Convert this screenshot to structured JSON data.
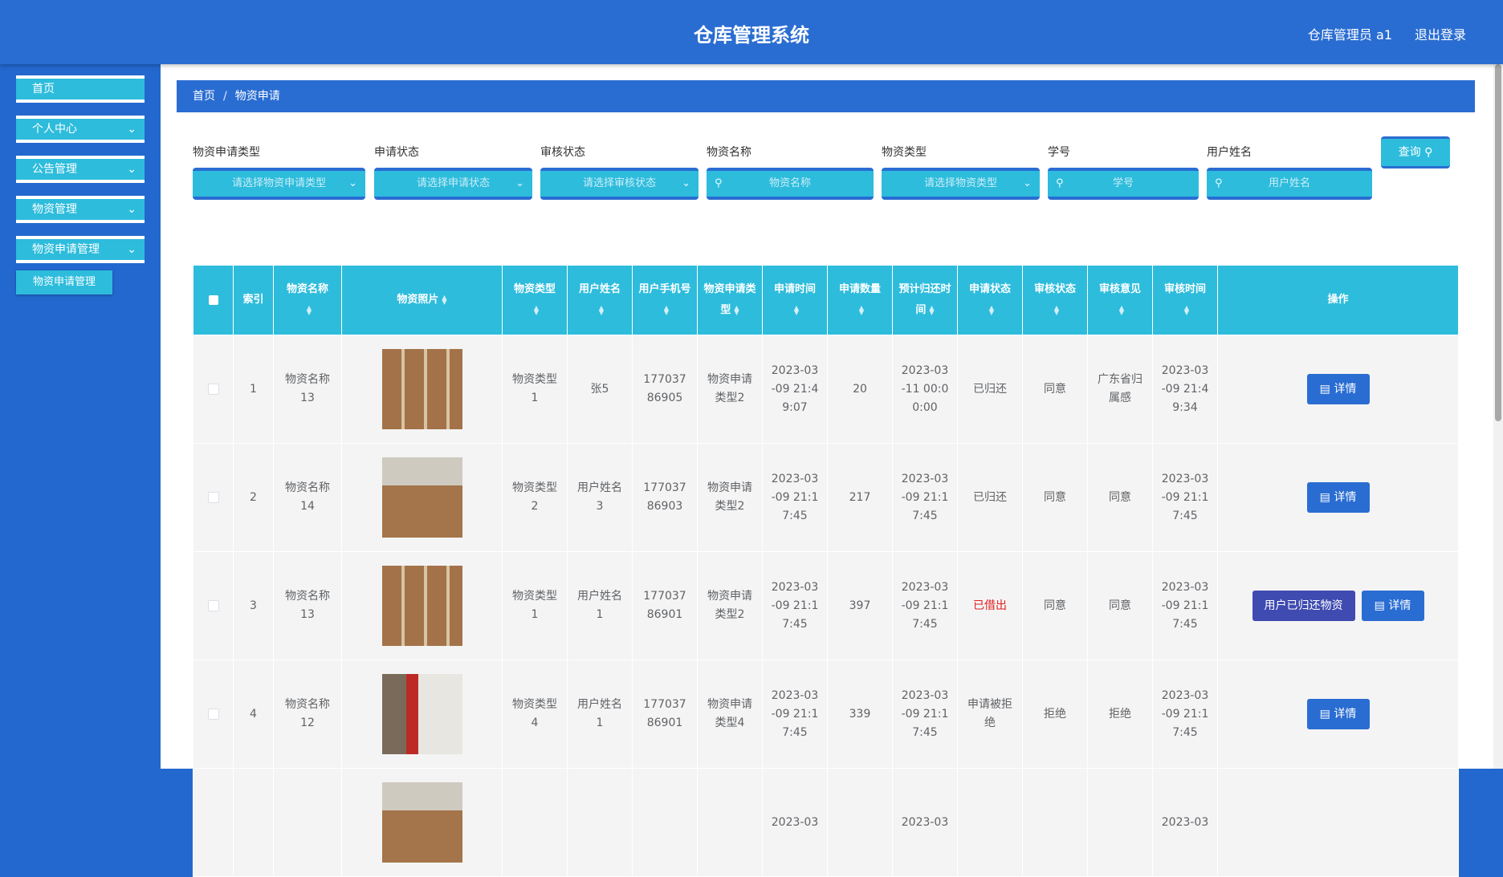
{
  "header": {
    "title": "仓库管理系统",
    "user": "仓库管理员 a1",
    "logout": "退出登录"
  },
  "sidebar": {
    "items": [
      {
        "label": "首页"
      },
      {
        "label": "个人中心"
      },
      {
        "label": "公告管理"
      },
      {
        "label": "物资管理"
      },
      {
        "label": "物资申请管理"
      }
    ],
    "submenu": "物资申请管理"
  },
  "breadcrumb": {
    "home": "首页",
    "sep": "/",
    "current": "物资申请"
  },
  "filters": {
    "apply_type": {
      "label": "物资申请类型",
      "placeholder": "请选择物资申请类型"
    },
    "apply_status": {
      "label": "申请状态",
      "placeholder": "请选择申请状态"
    },
    "review_status": {
      "label": "审核状态",
      "placeholder": "请选择审核状态"
    },
    "goods_name": {
      "label": "物资名称",
      "placeholder": "物资名称"
    },
    "goods_type": {
      "label": "物资类型",
      "placeholder": "请选择物资类型"
    },
    "student_no": {
      "label": "学号",
      "placeholder": "学号"
    },
    "user_name": {
      "label": "用户姓名",
      "placeholder": "用户姓名"
    },
    "query": "查询"
  },
  "table": {
    "headers": [
      "索引",
      "物资名称",
      "物资照片",
      "物资类型",
      "用户姓名",
      "用户手机号",
      "物资申请类型",
      "申请时间",
      "申请数量",
      "预计归还时间",
      "申请状态",
      "审核状态",
      "审核意见",
      "审核时间",
      "操作"
    ],
    "rows": [
      {
        "index": "1",
        "name": "物资名称13",
        "type": "物资类型1",
        "user": "张5",
        "phone": "17703786905",
        "apply_type": "物资申请类型2",
        "apply_time": "2023-03-09 21:49:07",
        "qty": "20",
        "return_time": "2023-03-11 00:00:00",
        "status": "已归还",
        "review": "同意",
        "opinion": "广东省归属感",
        "review_time": "2023-03-09 21:49:34"
      },
      {
        "index": "2",
        "name": "物资名称14",
        "type": "物资类型2",
        "user": "用户姓名3",
        "phone": "17703786903",
        "apply_type": "物资申请类型2",
        "apply_time": "2023-03-09 21:17:45",
        "qty": "217",
        "return_time": "2023-03-09 21:17:45",
        "status": "已归还",
        "review": "同意",
        "opinion": "同意",
        "review_time": "2023-03-09 21:17:45"
      },
      {
        "index": "3",
        "name": "物资名称13",
        "type": "物资类型1",
        "user": "用户姓名1",
        "phone": "17703786901",
        "apply_type": "物资申请类型2",
        "apply_time": "2023-03-09 21:17:45",
        "qty": "397",
        "return_time": "2023-03-09 21:17:45",
        "status": "已借出",
        "review": "同意",
        "opinion": "同意",
        "review_time": "2023-03-09 21:17:45"
      },
      {
        "index": "4",
        "name": "物资名称12",
        "type": "物资类型4",
        "user": "用户姓名1",
        "phone": "17703786901",
        "apply_type": "物资申请类型4",
        "apply_time": "2023-03-09 21:17:45",
        "qty": "339",
        "return_time": "2023-03-09 21:17:45",
        "status": "申请被拒绝",
        "review": "拒绝",
        "opinion": "拒绝",
        "review_time": "2023-03-09 21:17:45"
      }
    ],
    "partial_row": {
      "apply_time": "2023-03",
      "return_time": "2023-03",
      "review_time": "2023-03"
    },
    "btn_detail": "详情",
    "btn_return": "用户已归还物资"
  },
  "colors": {
    "primary": "#2a6dd2",
    "accent": "#2dbcdc",
    "danger": "#e21e1e",
    "return_btn": "#3f4bb0"
  }
}
